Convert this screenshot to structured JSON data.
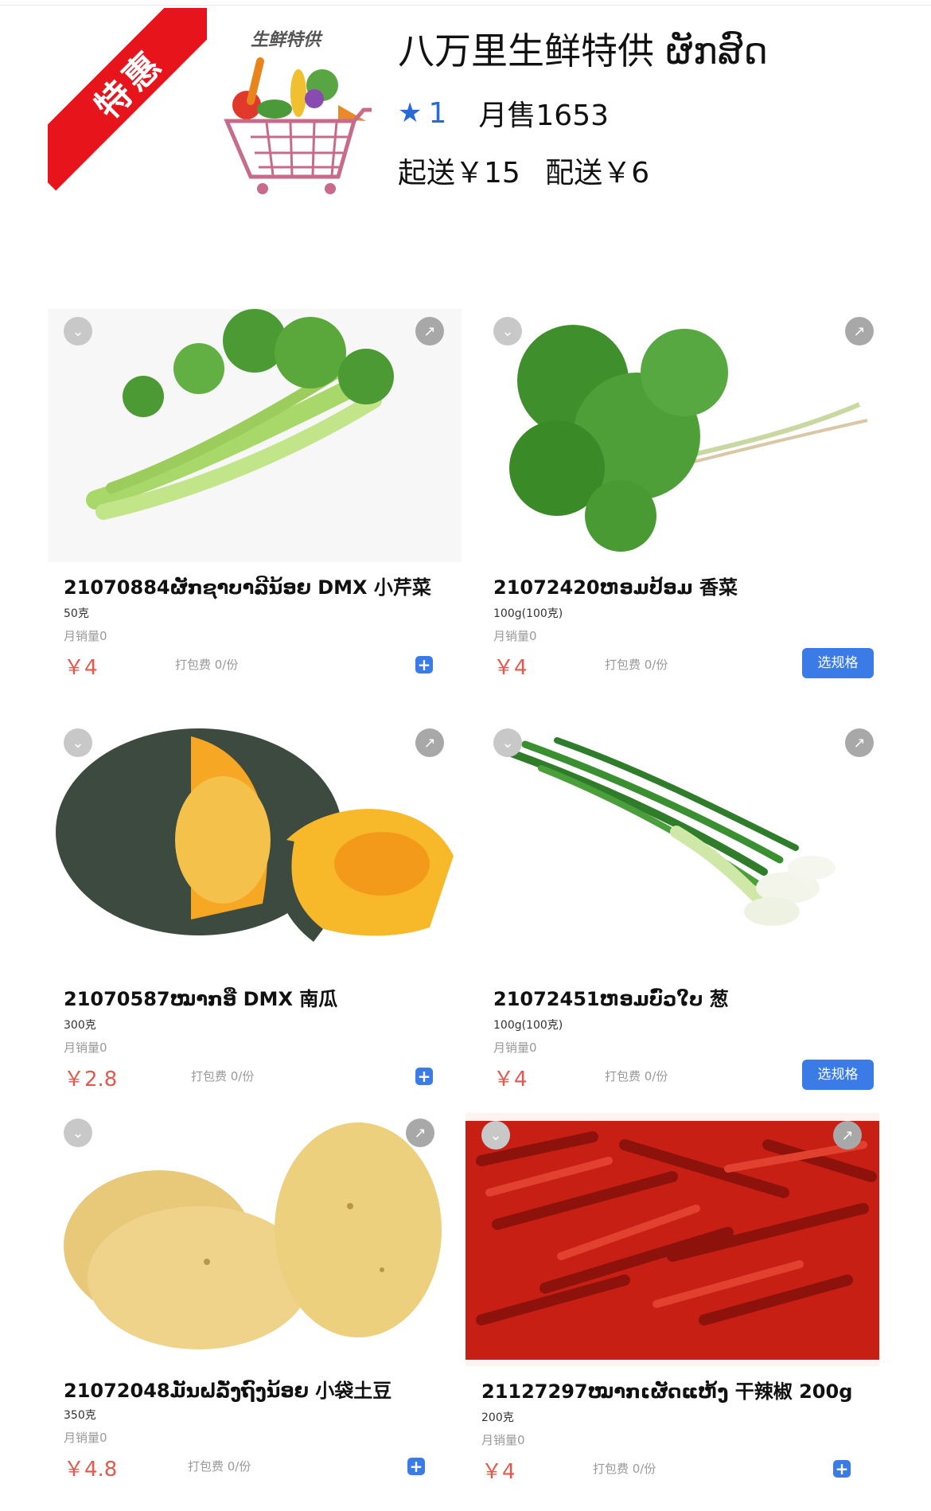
{
  "header": {
    "ribbon_text": "特惠",
    "logo_text": "生鲜特供",
    "shop_name": "八万里生鲜特供 ຜັກສົດ",
    "rating": "1",
    "monthly_sales": "月售1653",
    "min_order": "起送￥15",
    "delivery_fee": "配送￥6"
  },
  "products": [
    {
      "title": "21070884ຜັກຊາບາລີນ້ອຍ DMX 小芹菜",
      "spec": "50克",
      "sales": "月销量0",
      "price": "￥4",
      "pack_fee": "打包费 0/份",
      "action": "add",
      "add_label": "+",
      "image": "celery"
    },
    {
      "title": "21072420ຫອມປ້ອມ 香菜",
      "spec": "100g(100克)",
      "sales": "月销量0",
      "price": "￥4",
      "pack_fee": "打包费 0/份",
      "action": "spec",
      "spec_button_label": "选规格",
      "image": "coriander"
    },
    {
      "title": "21070587ໝາກອື DMX 南瓜",
      "spec": "300克",
      "sales": "月销量0",
      "price": "￥2.8",
      "pack_fee": "打包费 0/份",
      "action": "add",
      "add_label": "+",
      "image": "pumpkin"
    },
    {
      "title": "21072451ຫອມບົ່ວໃບ 葱",
      "spec": "100g(100克)",
      "sales": "月销量0",
      "price": "￥4",
      "pack_fee": "打包费 0/份",
      "action": "spec",
      "spec_button_label": "选规格",
      "image": "scallion"
    },
    {
      "title": "21072048ມັນຝລັ່ງຖົງນ້ອຍ 小袋土豆",
      "spec": "350克",
      "sales": "月销量0",
      "price": "￥4.8",
      "pack_fee": "打包费 0/份",
      "action": "add",
      "add_label": "+",
      "image": "potato"
    },
    {
      "title": "21127297ໝາກເຜັດແຫ້ງ 干辣椒 200g",
      "spec": "200克",
      "sales": "月销量0",
      "price": "￥4",
      "pack_fee": "打包费 0/份",
      "action": "add",
      "add_label": "+",
      "image": "chili"
    }
  ],
  "icons": {
    "collapse": "chevron-down-icon",
    "share": "share-icon",
    "rating": "star-icon",
    "add": "plus-icon"
  },
  "colors": {
    "accent": "#3a7be8",
    "price": "#e25a4e",
    "ribbon": "#e8141c",
    "star": "#2a6ad8"
  }
}
